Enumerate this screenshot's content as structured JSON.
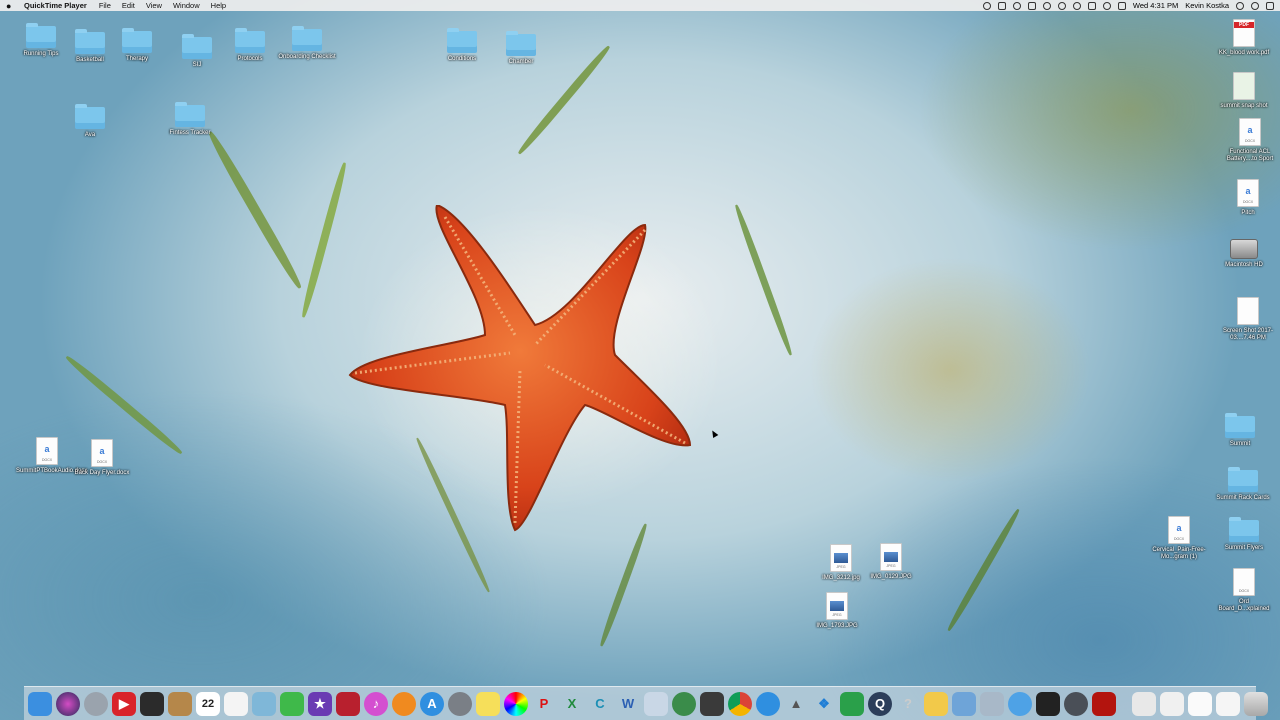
{
  "menubar": {
    "app_name": "QuickTime Player",
    "menus": [
      "File",
      "Edit",
      "View",
      "Window",
      "Help"
    ],
    "clock": "Wed 4:31 PM",
    "user": "Kevin Kostka"
  },
  "desktop": {
    "folders": [
      {
        "label": "Running Tips"
      },
      {
        "label": "Basketball"
      },
      {
        "label": "Therapy"
      },
      {
        "label": "SIJ"
      },
      {
        "label": "Protocols"
      },
      {
        "label": "Onboarding Checklist"
      },
      {
        "label": "Conditions"
      },
      {
        "label": "Chamber"
      },
      {
        "label": "Ava"
      },
      {
        "label": "Fintess Tracker"
      },
      {
        "label": "Summit"
      },
      {
        "label": "Summit Rack Cards"
      },
      {
        "label": "Summit Flyers"
      }
    ],
    "files": [
      {
        "label": "KK_blood work.pdf",
        "badge": "PDF"
      },
      {
        "label": "summit snap shot",
        "badge": ""
      },
      {
        "label": "Functional ACL Battery....to Sport",
        "badge": "a"
      },
      {
        "label": "Pitch",
        "badge": "a"
      },
      {
        "label": "Macintosh HD",
        "badge": ""
      },
      {
        "label": "Screen Shot 2017-03....7.46 PM",
        "badge": ""
      },
      {
        "label": "SummitPTBookAudio.docx",
        "badge": "a"
      },
      {
        "label": "Back Day Flyer.docx",
        "badge": "a"
      },
      {
        "label": "IMG_3212.jpg",
        "badge": "JPEG"
      },
      {
        "label": "IMG_0129.JPG",
        "badge": "JPEG"
      },
      {
        "label": "IMG_1793.JPG",
        "badge": "JPEG"
      },
      {
        "label": "Cervical_Pain-Free-Mo...gram (1)",
        "badge": "a"
      },
      {
        "label": "Ord Board_D...xplained",
        "badge": "DOCX"
      }
    ]
  },
  "dock": {
    "calendar_day": "22",
    "items": [
      "finder",
      "siri",
      "launchpad",
      "youtube",
      "photo-booth",
      "notes",
      "calendar",
      "stickies",
      "preview",
      "facetime",
      "imovie",
      "photos",
      "itunes",
      "ibooks",
      "app-store",
      "system-preferences",
      "notes-yellow",
      "color-picker",
      "pin",
      "excel",
      "c-app",
      "word",
      "preview2",
      "network",
      "stickies2",
      "chrome",
      "safari",
      "airdrop",
      "dropbox",
      "numbers",
      "quicktime",
      "help",
      "messages",
      "mail",
      "image-capture",
      "chat",
      "cube",
      "acrobat"
    ],
    "colors": {
      "finder": "#3b8fe0",
      "siri": "#2a2a5a",
      "youtube": "#d9232a",
      "excel": "#1f8a3c",
      "word": "#2b5fb3",
      "chrome": "#e8e8e8",
      "safari": "#2f8fe0",
      "acrobat": "#b3140e"
    }
  }
}
